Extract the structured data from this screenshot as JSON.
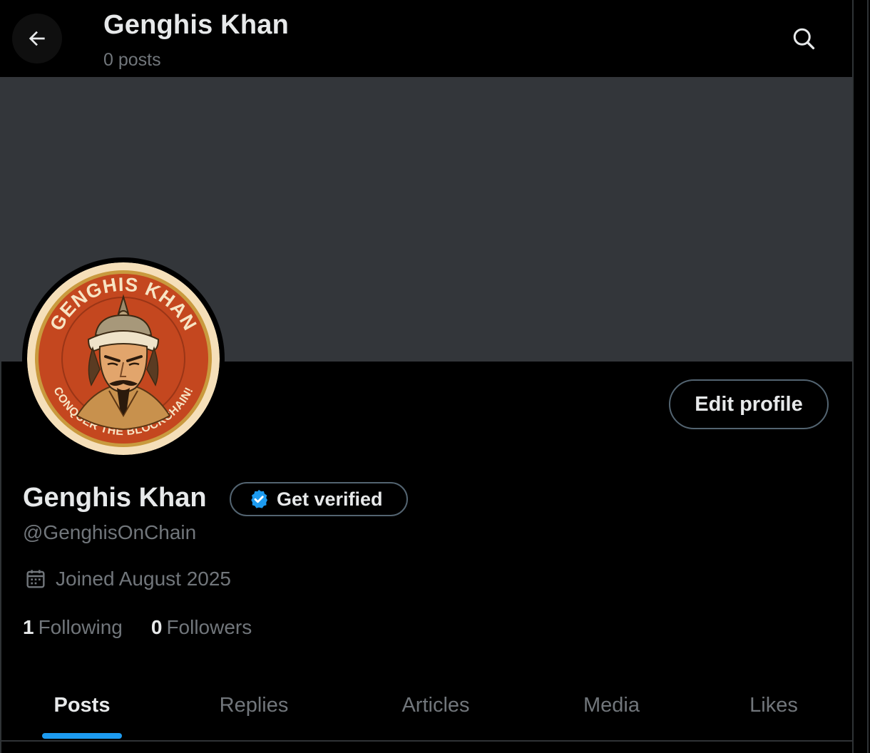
{
  "header": {
    "title": "Genghis Khan",
    "post_count": "0 posts",
    "back_icon": "arrow-left-icon",
    "search_icon": "search-icon"
  },
  "profile": {
    "display_name": "Genghis Khan",
    "handle": "@GenghisOnChain",
    "edit_label": "Edit profile",
    "verified_label": "Get verified",
    "joined": "Joined August 2025",
    "avatar": {
      "top_text": "GENGHIS KHAN",
      "bottom_text": "CONQUER THE BLOCKCHAIN!"
    }
  },
  "stats": {
    "following_count": "1",
    "following_label": "Following",
    "followers_count": "0",
    "followers_label": "Followers"
  },
  "tabs": [
    {
      "label": "Posts",
      "active": true
    },
    {
      "label": "Replies",
      "active": false
    },
    {
      "label": "Articles",
      "active": false
    },
    {
      "label": "Media",
      "active": false
    },
    {
      "label": "Likes",
      "active": false
    }
  ],
  "colors": {
    "accent": "#1d9bf0",
    "background": "#000000",
    "banner": "#33363a",
    "secondary_text": "#71767b",
    "border": "#536471"
  }
}
